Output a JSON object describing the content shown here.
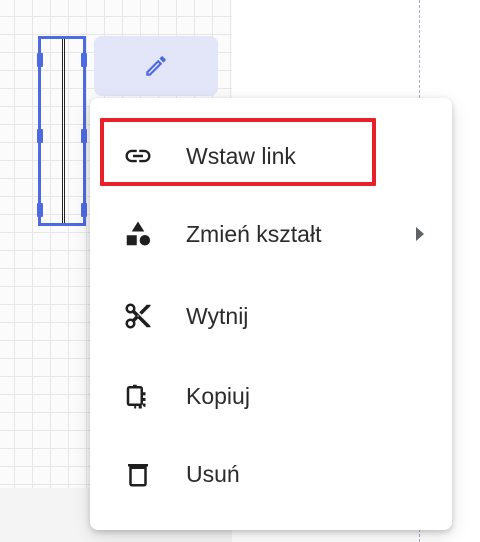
{
  "toolbar": {
    "edit_icon": "pencil-icon"
  },
  "context_menu": {
    "items": [
      {
        "label": "Wstaw link",
        "icon": "link-icon",
        "highlighted": true
      },
      {
        "label": "Zmień kształt",
        "icon": "shapes-icon",
        "has_submenu": true
      },
      {
        "label": "Wytnij",
        "icon": "scissors-icon"
      },
      {
        "label": "Kopiuj",
        "icon": "copy-icon"
      },
      {
        "label": "Usuń",
        "icon": "trash-icon"
      }
    ]
  },
  "colors": {
    "selection": "#4d6ae0",
    "edit_button_bg": "#e3e6f8",
    "highlight": "#e8202a",
    "text": "#2b2b2b",
    "icon": "#1f1f1f"
  }
}
